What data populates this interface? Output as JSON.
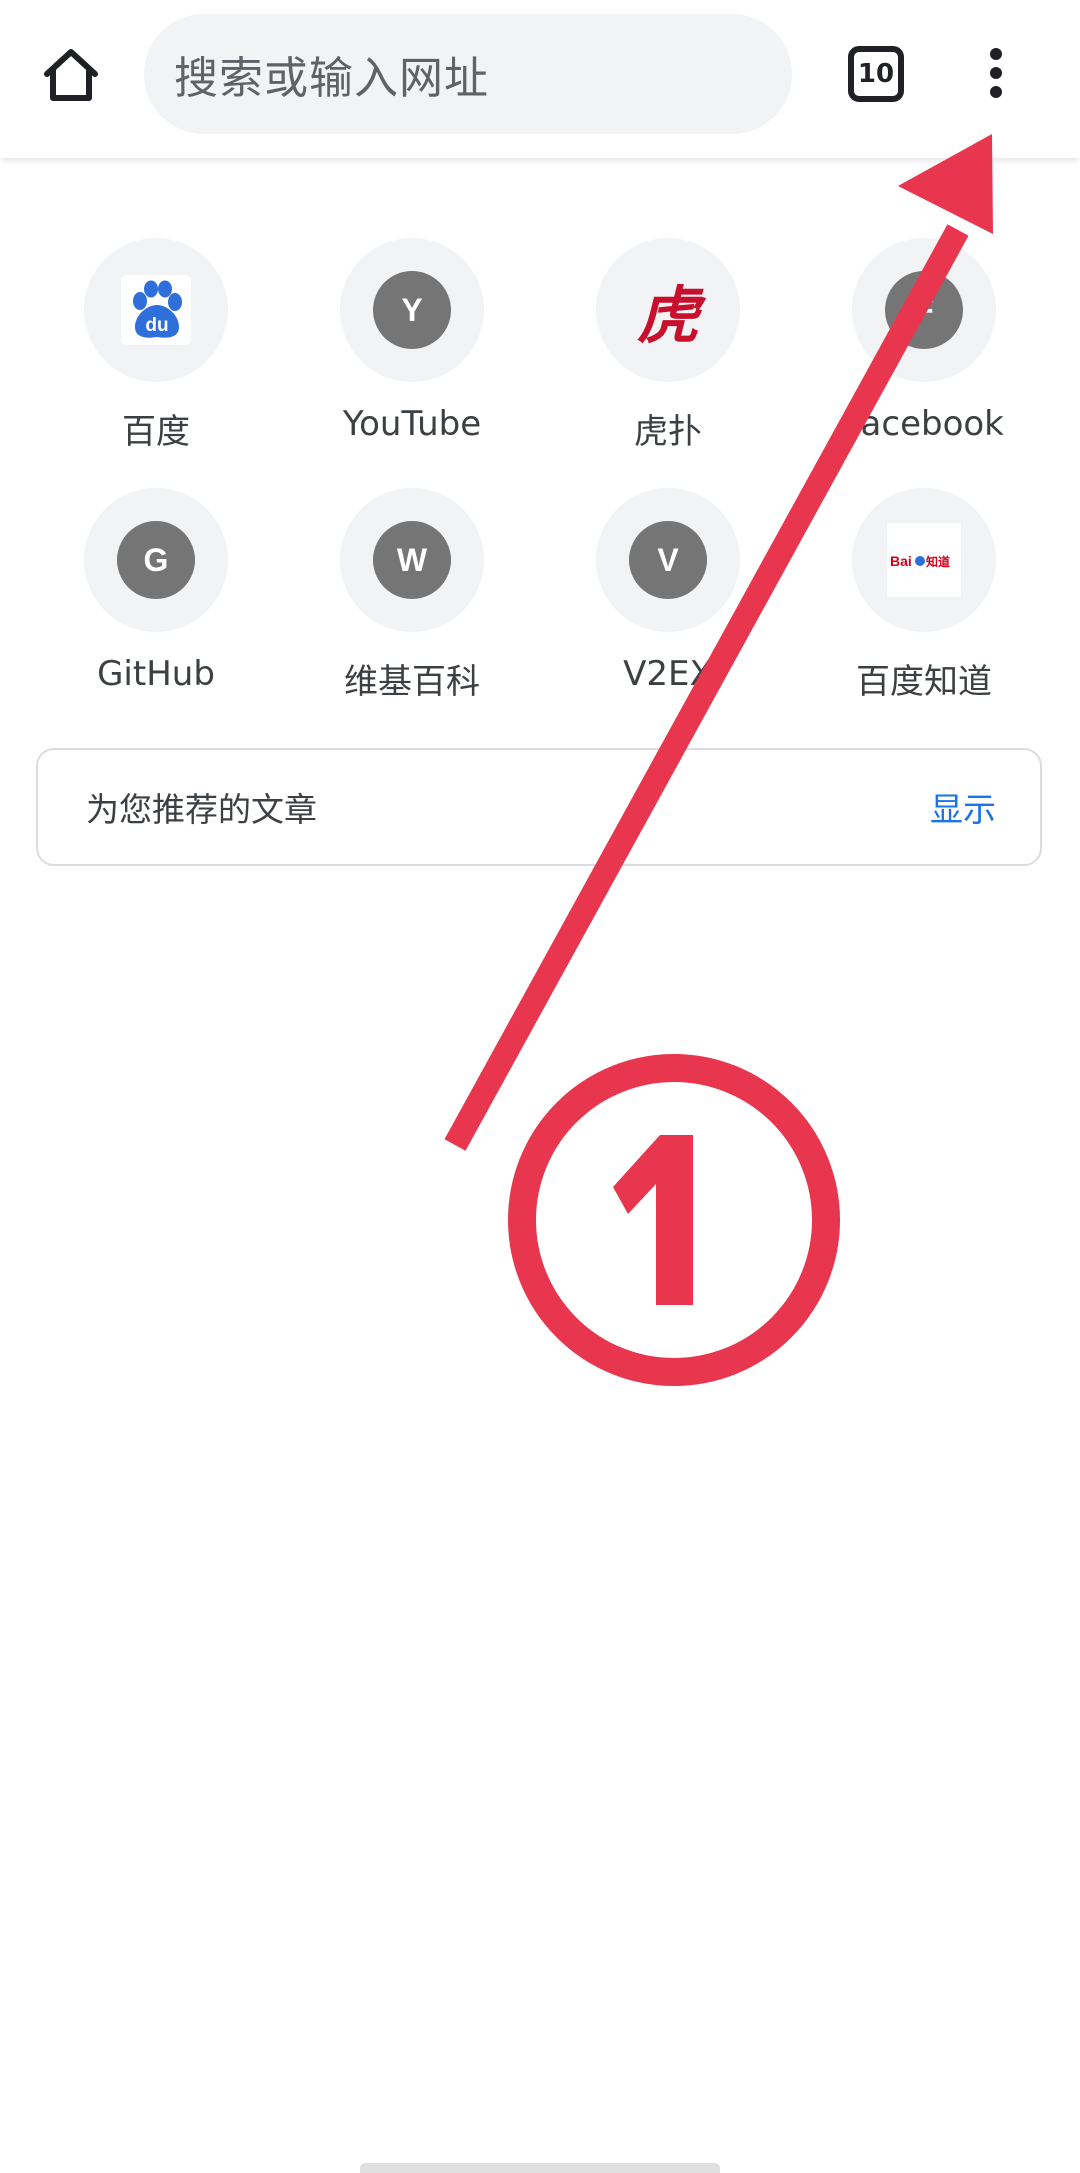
{
  "toolbar": {
    "search_placeholder": "搜索或输入网址",
    "tab_count": "10",
    "home_icon": "home-icon",
    "menu_icon": "more-vert-icon"
  },
  "tiles": [
    {
      "label": "百度",
      "icon": "baidu-logo-icon"
    },
    {
      "label": "YouTube",
      "icon": "letter-icon",
      "letter": "Y"
    },
    {
      "label": "虎扑",
      "icon": "hupu-logo-icon",
      "glyph": "虎"
    },
    {
      "label": "Facebook",
      "icon": "letter-icon",
      "letter": "F"
    },
    {
      "label": "GitHub",
      "icon": "letter-icon",
      "letter": "G"
    },
    {
      "label": "维基百科",
      "icon": "letter-icon",
      "letter": "W"
    },
    {
      "label": "V2EX",
      "icon": "letter-icon",
      "letter": "V"
    },
    {
      "label": "百度知道",
      "icon": "baidu-zhidao-logo-icon"
    }
  ],
  "articles": {
    "title": "为您推荐的文章",
    "action": "显示"
  },
  "annotation": {
    "marker": "①",
    "color": "#e8364f"
  }
}
